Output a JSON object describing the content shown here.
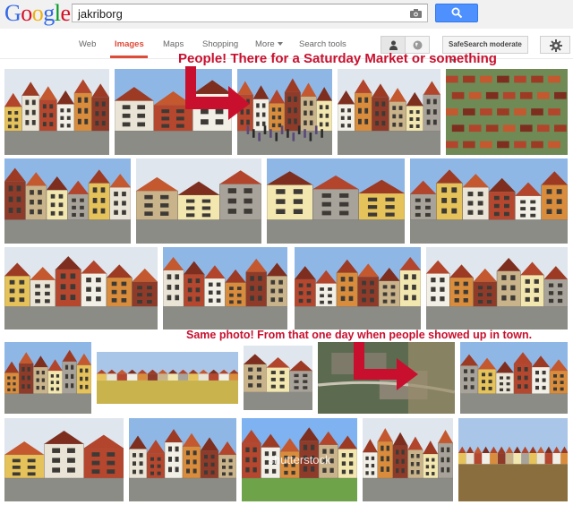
{
  "logo": {
    "letters": [
      "G",
      "o",
      "o",
      "g",
      "l",
      "e"
    ],
    "colors": [
      "#3369e8",
      "#d50f25",
      "#eeb211",
      "#3369e8",
      "#009925",
      "#d50f25"
    ]
  },
  "search": {
    "query": "jakriborg"
  },
  "nav": {
    "tabs": [
      "Web",
      "Images",
      "Maps",
      "Shopping",
      "More",
      "Search tools"
    ],
    "active_tab": "Images",
    "safesearch_label": "SafeSearch moderate"
  },
  "colors": {
    "accent": "#dd4b39",
    "search_button": "#4d90fe",
    "annotation": "#c8102e"
  },
  "annotations": {
    "top": "People! There for a Saturday Market or something",
    "bottom": "Same photo! From that one day when people showed up in town."
  },
  "results": [
    {
      "kind": "street"
    },
    {
      "kind": "facade"
    },
    {
      "kind": "market"
    },
    {
      "kind": "street"
    },
    {
      "kind": "aerial"
    },
    {
      "kind": "street"
    },
    {
      "kind": "facade"
    },
    {
      "kind": "facade"
    },
    {
      "kind": "street"
    },
    {
      "kind": "street"
    },
    {
      "kind": "street"
    },
    {
      "kind": "street"
    },
    {
      "kind": "street"
    },
    {
      "kind": "street"
    },
    {
      "kind": "panorama"
    },
    {
      "kind": "facade"
    },
    {
      "kind": "satellite"
    },
    {
      "kind": "street"
    },
    {
      "kind": "facade"
    },
    {
      "kind": "street"
    },
    {
      "kind": "watermark",
      "watermark": "shutterstock"
    },
    {
      "kind": "street"
    },
    {
      "kind": "field"
    }
  ]
}
